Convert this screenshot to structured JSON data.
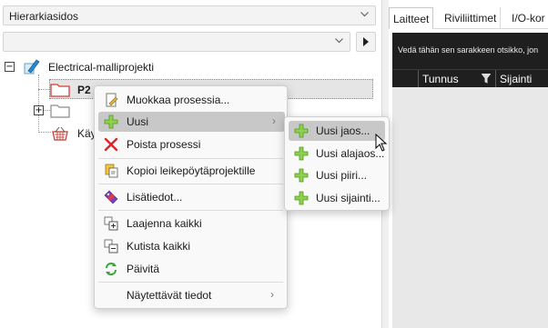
{
  "left": {
    "hierarchy_combo": {
      "value": "Hierarkiasidos",
      "icon": "chevron-down-icon"
    },
    "filter_combo": {
      "value": "",
      "icon": "chevron-down-icon"
    },
    "go_button_icon": "play-arrow-icon",
    "tree": {
      "root": {
        "label": "Electrical-malliprojekti",
        "expander": "−",
        "icon": "pen-project-icon"
      },
      "children": [
        {
          "label": "P2",
          "icon": "red-folder-icon",
          "selected": true
        },
        {
          "label": "",
          "icon": "folder-icon",
          "expander": "+"
        },
        {
          "label": "Käy",
          "icon": "basket-icon"
        }
      ]
    }
  },
  "right": {
    "tabs": [
      "Laitteet",
      "Riviliittimet",
      "I/O-kor"
    ],
    "active_tab": 0,
    "group_hint": "Vedä tähän sen sarakkeen otsikko, jon",
    "columns": [
      "Tunnus",
      "Sijainti"
    ],
    "filter_icon": "filter-icon"
  },
  "context_menu": {
    "items": [
      {
        "label": "Muokkaa prosessia...",
        "icon": "edit-doc-icon"
      },
      {
        "label": "Uusi",
        "icon": "plus-icon",
        "submenu": "›",
        "highlighted": true
      },
      {
        "label": "Poista prosessi",
        "icon": "delete-x-icon"
      },
      {
        "separator": true
      },
      {
        "label": "Kopioi leikepöytäprojektille",
        "icon": "clipboard-icon"
      },
      {
        "separator": true
      },
      {
        "label": "Lisätiedot...",
        "icon": "info-tag-icon"
      },
      {
        "separator": true
      },
      {
        "label": "Laajenna kaikki",
        "icon": "expand-all-icon"
      },
      {
        "label": "Kutista kaikki",
        "icon": "collapse-all-icon"
      },
      {
        "label": "Päivitä",
        "icon": "refresh-icon"
      },
      {
        "separator": true
      },
      {
        "label": "Näytettävät tiedot",
        "submenu": "›"
      }
    ]
  },
  "sub_menu": {
    "items": [
      {
        "label": "Uusi jaos...",
        "icon": "plus-icon",
        "highlighted": true
      },
      {
        "label": "Uusi alajaos...",
        "icon": "plus-icon"
      },
      {
        "label": "Uusi piiri...",
        "icon": "plus-icon"
      },
      {
        "label": "Uusi sijainti...",
        "icon": "plus-icon"
      }
    ]
  },
  "colors": {
    "plus_green": "#6cbf2a",
    "delete_red": "#d9262b",
    "folder_red": "#d63a3a",
    "highlight": "#c8c8c8"
  }
}
